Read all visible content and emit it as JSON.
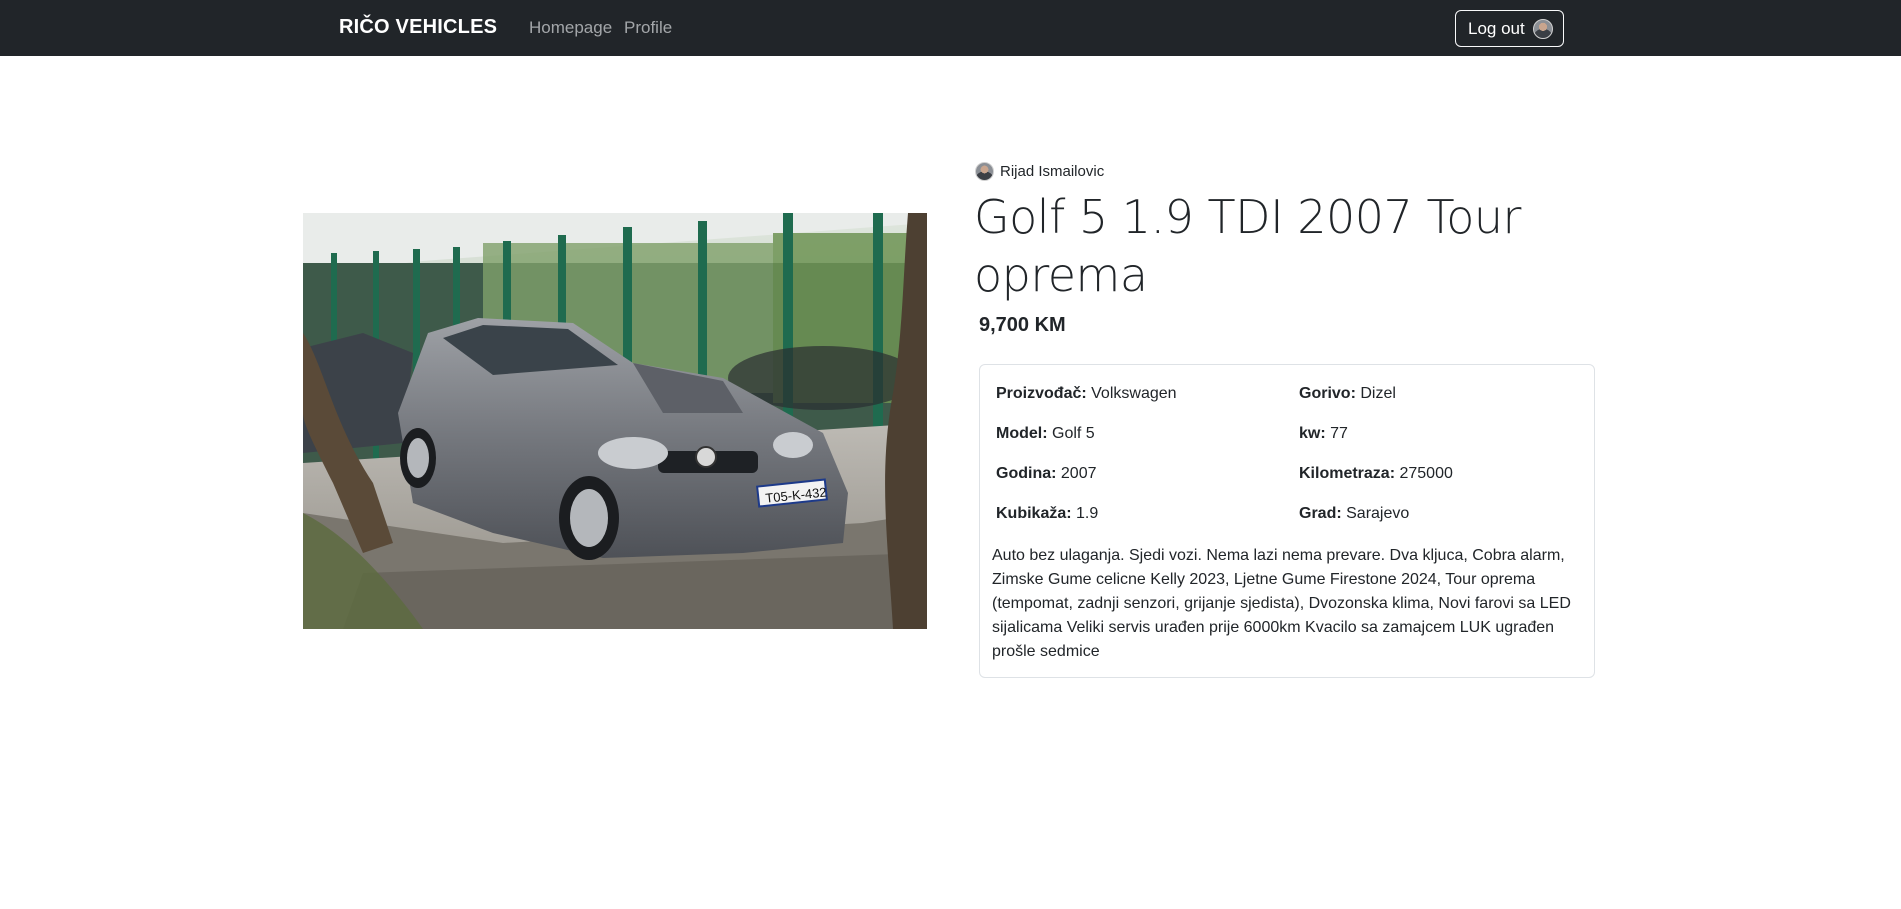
{
  "nav": {
    "brand": "RIČO VEHICLES",
    "links": [
      {
        "label": "Homepage"
      },
      {
        "label": "Profile"
      }
    ],
    "logout_label": "Log out"
  },
  "listing": {
    "author": "Rijad Ismailovic",
    "title": "Golf 5 1.9 TDI 2007 Tour oprema",
    "price": "9,700 KM",
    "plate": "T05-K-432",
    "specs": {
      "manufacturer": {
        "label": "Proizvođač:",
        "value": "Volkswagen"
      },
      "fuel": {
        "label": "Gorivo:",
        "value": "Dizel"
      },
      "model": {
        "label": "Model:",
        "value": "Golf 5"
      },
      "kw": {
        "label": "kw:",
        "value": "77"
      },
      "year": {
        "label": "Godina:",
        "value": "2007"
      },
      "mileage": {
        "label": "Kilometraza:",
        "value": "275000"
      },
      "displacement": {
        "label": "Kubikaža:",
        "value": "1.9"
      },
      "city": {
        "label": "Grad:",
        "value": "Sarajevo"
      }
    },
    "description": "Auto bez ulaganja. Sjedi vozi. Nema lazi nema prevare. Dva kljuca, Cobra alarm, Zimske Gume celicne Kelly 2023, Ljetne Gume Firestone 2024, Tour oprema (tempomat, zadnji senzori, grijanje sjedista), Dvozonska klima, Novi farovi sa LED sijalicama Veliki servis urađen prije 6000km Kvacilo sa zamajcem LUK ugrađen prošle sedmice"
  },
  "colors": {
    "navbar_bg": "#212529",
    "nav_link": "#a3a6a9",
    "text": "#212529",
    "card_border": "#dee2e6"
  },
  "icons": [
    "user-avatar-icon",
    "author-avatar-icon"
  ]
}
